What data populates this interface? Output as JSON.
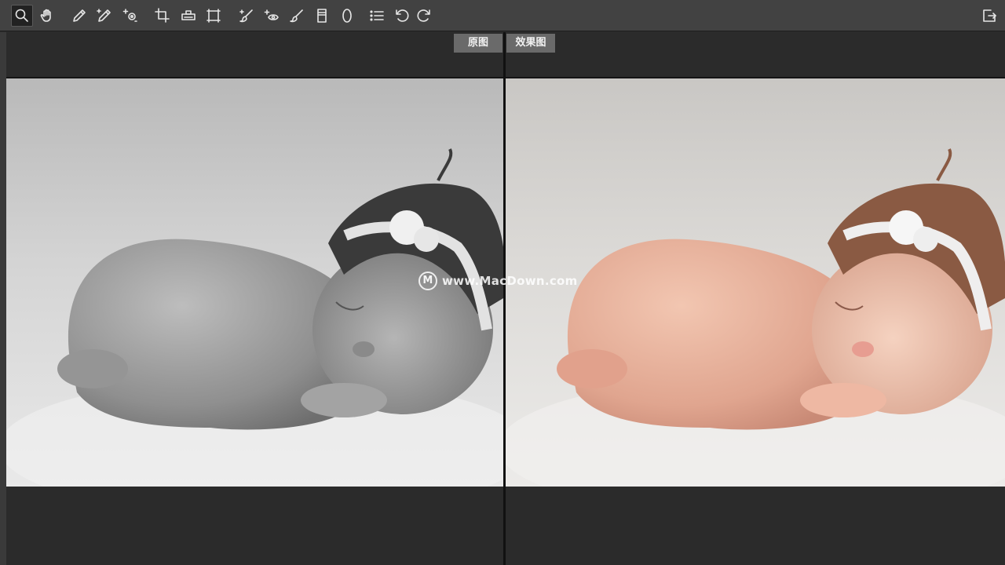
{
  "toolbar": {
    "tools": [
      {
        "name": "zoom-tool",
        "icon": "magnifier-icon",
        "active": true
      },
      {
        "name": "hand-tool",
        "icon": "hand-icon"
      },
      {
        "name": "white-balance-tool",
        "icon": "eyedropper-icon"
      },
      {
        "name": "color-sampler-tool",
        "icon": "sampler-eyedropper-icon"
      },
      {
        "name": "targeted-adjustment-tool",
        "icon": "target-adjust-icon"
      },
      {
        "name": "crop-tool",
        "icon": "crop-icon"
      },
      {
        "name": "straighten-tool",
        "icon": "level-icon"
      },
      {
        "name": "transform-tool",
        "icon": "transform-icon"
      },
      {
        "name": "spot-removal-tool",
        "icon": "brush-heal-icon"
      },
      {
        "name": "red-eye-tool",
        "icon": "red-eye-icon"
      },
      {
        "name": "adjustment-brush-tool",
        "icon": "brush-icon"
      },
      {
        "name": "graduated-filter-tool",
        "icon": "gradient-icon"
      },
      {
        "name": "radial-filter-tool",
        "icon": "ellipse-icon"
      },
      {
        "name": "preferences-tool",
        "icon": "list-icon"
      },
      {
        "name": "rotate-left-tool",
        "icon": "rotate-ccw-icon"
      },
      {
        "name": "rotate-right-tool",
        "icon": "rotate-cw-icon"
      }
    ],
    "export_icon": "export-icon"
  },
  "compare": {
    "before_label": "原图",
    "after_label": "效果图"
  },
  "watermark": {
    "logo": "M",
    "text": "www.MacDown.com"
  },
  "colors": {
    "toolbar_bg": "#424242",
    "workspace_bg": "#2b2b2b",
    "label_bg": "#6a6a6a"
  }
}
